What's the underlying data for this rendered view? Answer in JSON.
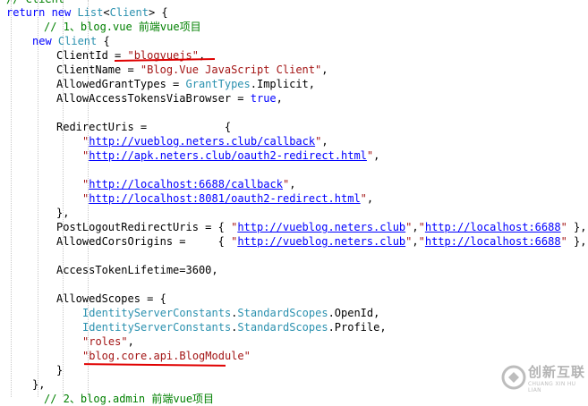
{
  "lines": [
    [
      {
        "c": "cm",
        "t": "// Client"
      }
    ],
    [
      {
        "c": "kw",
        "t": "return new "
      },
      {
        "c": "ty",
        "t": "List"
      },
      {
        "c": "pl",
        "t": "<"
      },
      {
        "c": "ty",
        "t": "Client"
      },
      {
        "c": "pl",
        "t": "> {"
      }
    ],
    [
      {
        "c": "cm",
        "t": "// 1、blog.vue 前端vue项目"
      }
    ],
    [
      {
        "c": "kw",
        "t": "new "
      },
      {
        "c": "ty",
        "t": "Client"
      },
      {
        "c": "pl",
        "t": " {"
      }
    ],
    [
      {
        "c": "pl",
        "t": "ClientId = "
      },
      {
        "c": "str",
        "t": "\"blogvuejs\""
      },
      {
        "c": "pl",
        "t": ","
      }
    ],
    [
      {
        "c": "pl",
        "t": "ClientName = "
      },
      {
        "c": "str",
        "t": "\"Blog.Vue JavaScript Client\""
      },
      {
        "c": "pl",
        "t": ","
      }
    ],
    [
      {
        "c": "pl",
        "t": "AllowedGrantTypes = "
      },
      {
        "c": "ty",
        "t": "GrantTypes"
      },
      {
        "c": "pl",
        "t": ".Implicit,"
      }
    ],
    [
      {
        "c": "pl",
        "t": "AllowAccessTokensViaBrowser = "
      },
      {
        "c": "kw",
        "t": "true"
      },
      {
        "c": "pl",
        "t": ","
      }
    ],
    [],
    [
      {
        "c": "pl",
        "t": "RedirectUris =            {"
      }
    ],
    [
      {
        "c": "str",
        "t": "\""
      },
      {
        "c": "lnk",
        "t": "http://vueblog.neters.club/callback"
      },
      {
        "c": "str",
        "t": "\""
      },
      {
        "c": "pl",
        "t": ","
      }
    ],
    [
      {
        "c": "str",
        "t": "\""
      },
      {
        "c": "lnk",
        "t": "http://apk.neters.club/oauth2-redirect.html"
      },
      {
        "c": "str",
        "t": "\""
      },
      {
        "c": "pl",
        "t": ","
      }
    ],
    [],
    [
      {
        "c": "str",
        "t": "\""
      },
      {
        "c": "lnk",
        "t": "http://localhost:6688/callback"
      },
      {
        "c": "str",
        "t": "\""
      },
      {
        "c": "pl",
        "t": ","
      }
    ],
    [
      {
        "c": "str",
        "t": "\""
      },
      {
        "c": "lnk",
        "t": "http://localhost:8081/oauth2-redirect.html"
      },
      {
        "c": "str",
        "t": "\""
      },
      {
        "c": "pl",
        "t": ","
      }
    ],
    [
      {
        "c": "pl",
        "t": "},"
      }
    ],
    [
      {
        "c": "pl",
        "t": "PostLogoutRedirectUris = { "
      },
      {
        "c": "str",
        "t": "\""
      },
      {
        "c": "lnk",
        "t": "http://vueblog.neters.club"
      },
      {
        "c": "str",
        "t": "\""
      },
      {
        "c": "pl",
        "t": ","
      },
      {
        "c": "str",
        "t": "\""
      },
      {
        "c": "lnk",
        "t": "http://localhost:6688"
      },
      {
        "c": "str",
        "t": "\""
      },
      {
        "c": "pl",
        "t": " },"
      }
    ],
    [
      {
        "c": "pl",
        "t": "AllowedCorsOrigins =     { "
      },
      {
        "c": "str",
        "t": "\""
      },
      {
        "c": "lnk",
        "t": "http://vueblog.neters.club"
      },
      {
        "c": "str",
        "t": "\""
      },
      {
        "c": "pl",
        "t": ","
      },
      {
        "c": "str",
        "t": "\""
      },
      {
        "c": "lnk",
        "t": "http://localhost:6688"
      },
      {
        "c": "str",
        "t": "\""
      },
      {
        "c": "pl",
        "t": " },"
      }
    ],
    [],
    [
      {
        "c": "pl",
        "t": "AccessTokenLifetime=3600,"
      }
    ],
    [],
    [
      {
        "c": "pl",
        "t": "AllowedScopes = {"
      }
    ],
    [
      {
        "c": "ty",
        "t": "IdentityServerConstants"
      },
      {
        "c": "pl",
        "t": "."
      },
      {
        "c": "ty",
        "t": "StandardScopes"
      },
      {
        "c": "pl",
        "t": ".OpenId,"
      }
    ],
    [
      {
        "c": "ty",
        "t": "IdentityServerConstants"
      },
      {
        "c": "pl",
        "t": "."
      },
      {
        "c": "ty",
        "t": "StandardScopes"
      },
      {
        "c": "pl",
        "t": ".Profile,"
      }
    ],
    [
      {
        "c": "str",
        "t": "\"roles\""
      },
      {
        "c": "pl",
        "t": ","
      }
    ],
    [
      {
        "c": "str",
        "t": "\"blog.core.api.BlogModule\""
      }
    ],
    [
      {
        "c": "pl",
        "t": "}"
      }
    ],
    [
      {
        "c": "pl",
        "t": "},"
      }
    ],
    [
      {
        "c": "cm",
        "t": "// 2、blog.admin 前端vue项目"
      }
    ]
  ],
  "watermark": {
    "brand": "创新互联",
    "tagline": "CHUANG XIN HU LIAN"
  },
  "colors": {
    "keyword": "#0000ff",
    "type": "#2b91af",
    "string": "#a31515",
    "comment": "#008000",
    "annotation": "#e00000"
  }
}
